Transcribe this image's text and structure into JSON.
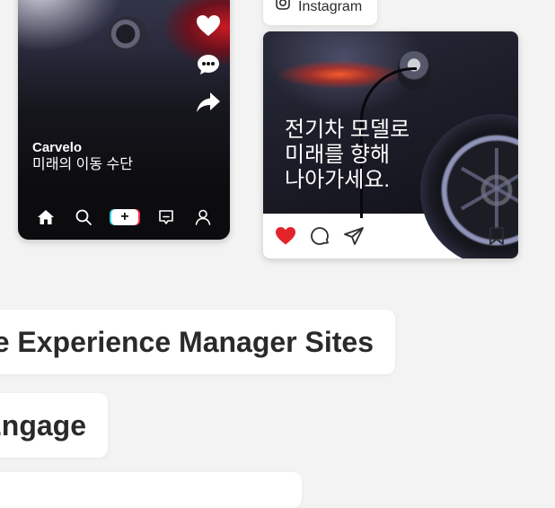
{
  "phone_card": {
    "author": "Carvelo",
    "caption": "미래의 이동 수단",
    "nav": {
      "add_label": "+"
    }
  },
  "instagram_card": {
    "pill_label": "Instagram",
    "post_text": "전기차 모델로\n미래를 향해\n나아가세요."
  },
  "product_labels": [
    {
      "text": "e Experience Manager Sites"
    },
    {
      "text": "Engage"
    },
    {
      "text": ""
    }
  ],
  "colors": {
    "page_background": "#f3f3f3",
    "like_red": "#e3242b",
    "card_white": "#ffffff"
  }
}
